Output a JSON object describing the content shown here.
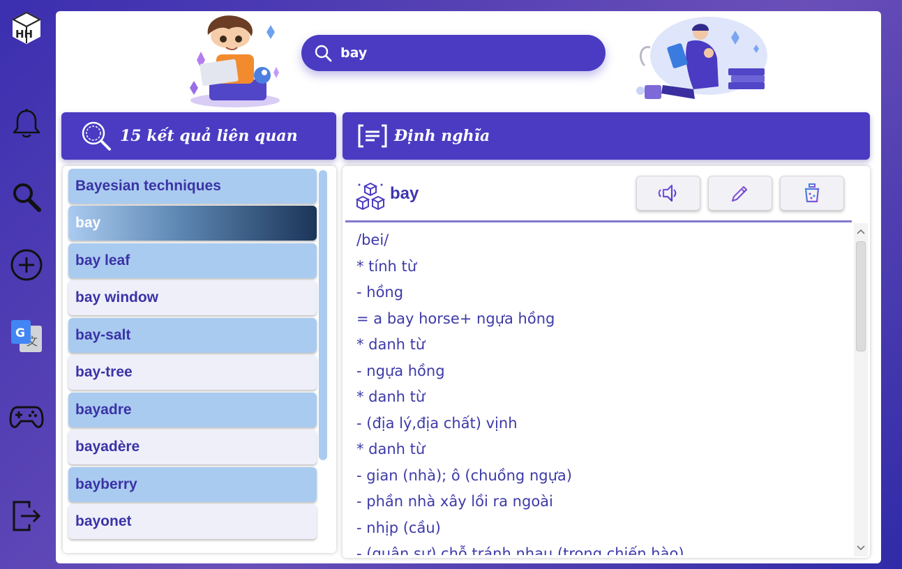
{
  "app": {
    "logo_text": "HH"
  },
  "sidebar": {
    "items": [
      {
        "name": "notifications",
        "icon": "bell-icon"
      },
      {
        "name": "search",
        "icon": "search-icon"
      },
      {
        "name": "add-word",
        "icon": "plus-circle-icon"
      },
      {
        "name": "translate",
        "icon": "google-translate-icon"
      },
      {
        "name": "games",
        "icon": "gamepad-icon"
      },
      {
        "name": "logout",
        "icon": "logout-icon"
      }
    ]
  },
  "search": {
    "value": "bay"
  },
  "results_header": {
    "title": "15 kết quả liên quan"
  },
  "definition_header": {
    "title": "Định nghĩa"
  },
  "results": [
    {
      "word": "Bayesian techniques",
      "style": "blue"
    },
    {
      "word": "bay",
      "style": "selected"
    },
    {
      "word": "bay leaf",
      "style": "blue"
    },
    {
      "word": "bay window",
      "style": "light"
    },
    {
      "word": "bay-salt",
      "style": "blue"
    },
    {
      "word": "bay-tree",
      "style": "light"
    },
    {
      "word": "bayadre",
      "style": "blue"
    },
    {
      "word": "bayadère",
      "style": "light"
    },
    {
      "word": "bayberry",
      "style": "blue"
    },
    {
      "word": "bayonet",
      "style": "light"
    }
  ],
  "definition": {
    "word": "bay",
    "lines": [
      "/bei/",
      "* tính từ",
      "- hồng",
      "= a bay horse+ ngựa hồng",
      "* danh từ",
      "- ngựa hồng",
      "* danh từ",
      "- (địa lý,địa chất) vịnh",
      "* danh từ",
      "- gian (nhà); ô (chuồng ngựa)",
      "- phần nhà xây lồi ra ngoài",
      "- nhịp (cầu)",
      "- (quân sự) chỗ tránh nhau (trong chiến hào)"
    ]
  },
  "colors": {
    "accent": "#4a3bc2",
    "item_blue": "#aacbf0",
    "item_light": "#efeffa",
    "text_purple": "#3a33a6"
  }
}
